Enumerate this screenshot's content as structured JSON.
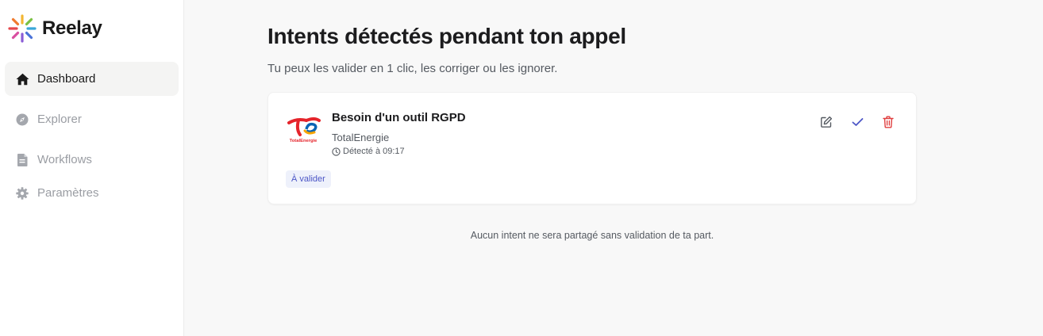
{
  "brand": {
    "name": "Reelay"
  },
  "sidebar": {
    "items": [
      {
        "label": "Dashboard",
        "icon": "home-icon",
        "active": true
      },
      {
        "label": "Explorer",
        "icon": "compass-icon",
        "active": false
      },
      {
        "label": "Workflows",
        "icon": "document-icon",
        "active": false
      },
      {
        "label": "Paramètres",
        "icon": "gear-icon",
        "active": false
      }
    ]
  },
  "main": {
    "title": "Intents détectés pendant ton appel",
    "subtitle": "Tu peux les valider en 1 clic, les corriger ou les ignorer.",
    "intents": [
      {
        "title": "Besoin d'un outil RGPD",
        "company": "TotalEnergie",
        "logo_text": "TotalEnergie",
        "detected": "Détecté à 09:17",
        "status": "À valider",
        "actions": [
          "edit-icon",
          "check-icon",
          "trash-icon"
        ]
      }
    ],
    "footer_note": "Aucun intent ne sera partagé sans validation de ta part."
  },
  "colors": {
    "accent": "#4b55c6",
    "danger": "#e03e3e",
    "badge_bg": "#eef1fb"
  }
}
